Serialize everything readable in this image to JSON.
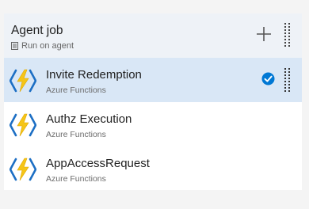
{
  "agent_job": {
    "title": "Agent job",
    "subtitle": "Run on agent",
    "icons": {
      "agent": "server-icon",
      "add": "plus-icon",
      "drag": "drag-handle-icon"
    }
  },
  "tasks": [
    {
      "name": "Invite Redemption",
      "type": "Azure Functions",
      "selected": true,
      "icon": "azure-functions-icon"
    },
    {
      "name": "Authz Execution",
      "type": "Azure Functions",
      "selected": false,
      "icon": "azure-functions-icon"
    },
    {
      "name": "AppAccessRequest",
      "type": "Azure Functions",
      "selected": false,
      "icon": "azure-functions-icon"
    }
  ],
  "colors": {
    "selected_row": "#d9e7f6",
    "header_bg": "#eef2f7",
    "accent_blue": "#0078d4",
    "lightning_yellow": "#f5c518"
  }
}
